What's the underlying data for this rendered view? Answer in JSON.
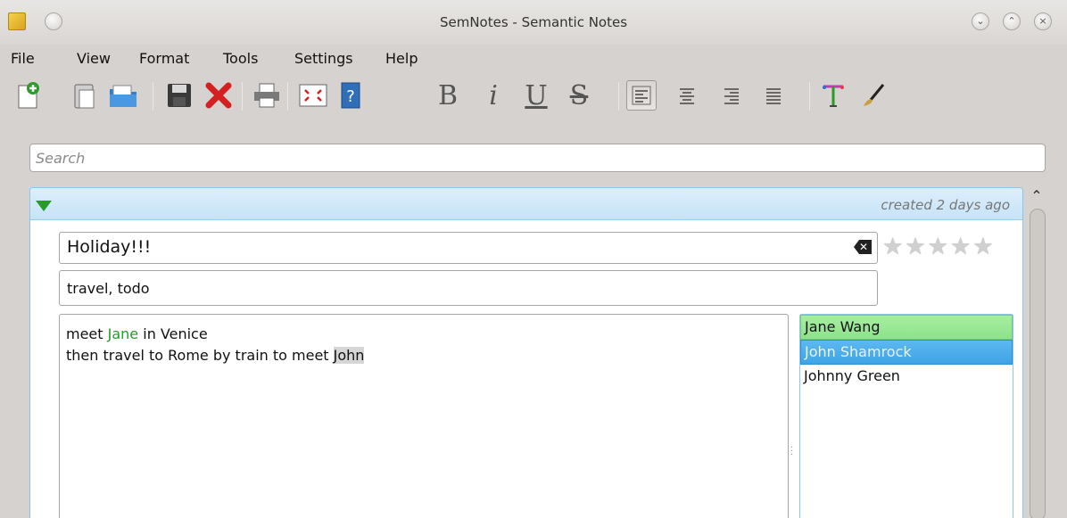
{
  "window": {
    "title": "SemNotes - Semantic Notes",
    "buttons": {
      "minimize": "⌄",
      "maximize": "⌃",
      "close": "×"
    }
  },
  "menu": [
    "File",
    "View",
    "Format",
    "Tools",
    "Settings",
    "Help"
  ],
  "toolbar": {
    "format": {
      "bold": "B",
      "italic": "i",
      "underline": "U",
      "strike": "S"
    }
  },
  "search": {
    "placeholder": "Search",
    "value": ""
  },
  "note": {
    "created": "created 2 days ago",
    "title": "Holiday!!!",
    "tags": "travel, todo",
    "rating": 0,
    "body": {
      "line1_pre": "meet ",
      "line1_entity": "Jane",
      "line1_post": " in Venice",
      "line2_pre": "then travel to Rome by train to meet ",
      "line2_entity": "John"
    },
    "people": [
      "Jane Wang",
      "John Shamrock",
      "Johnny Green"
    ]
  }
}
